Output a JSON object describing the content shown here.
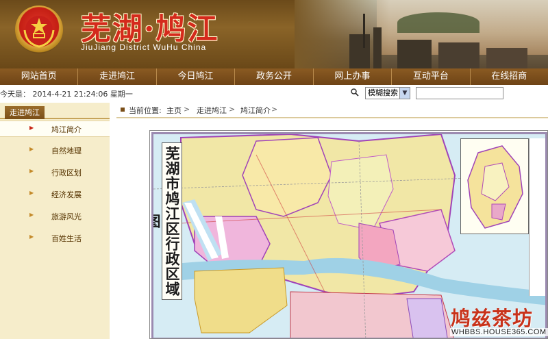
{
  "header": {
    "title": "芜湖·鸠江",
    "subtitle": "JiuJiang District WuHu China"
  },
  "nav": {
    "items": [
      "网站首页",
      "走进鸠江",
      "今日鸠江",
      "政务公开",
      "网上办事",
      "互动平台",
      "在线招商"
    ]
  },
  "infobar": {
    "today": "今天是： 2014-4-21 21:24:06 星期一",
    "search_mode": "模糊搜索",
    "search_value": ""
  },
  "sidebar": {
    "tab": "走进鸠江",
    "items": [
      "鸠江简介",
      "自然地理",
      "行政区划",
      "经济发展",
      "旅游风光",
      "百姓生活"
    ],
    "active": "鸠江简介"
  },
  "breadcrumb": {
    "prefix": "当前位置:",
    "items": [
      "主页",
      "走进鸠江",
      "鸠江简介"
    ]
  },
  "map": {
    "title": "芜湖市鸠江区行政区域图"
  },
  "watermark": {
    "logo": "鸠兹茶坊",
    "site": "WHBBS.HOUSE365.COM"
  },
  "colors": {
    "header_brown": "#6b4a1a",
    "nav_brown": "#7a4e18",
    "title_red": "#d42a1c",
    "sidebar_bg": "#f6edcb"
  }
}
